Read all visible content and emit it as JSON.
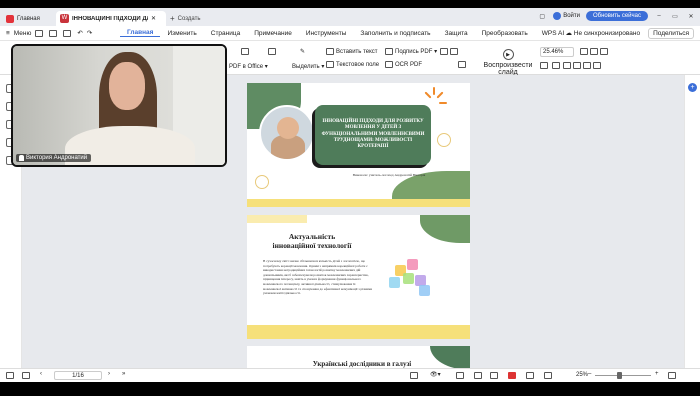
{
  "tabs": {
    "home_label": "Главная",
    "doc_title": "ІННОВАЦІЙНІ ПІДХОДИ ДЛ",
    "create_label": "Создать"
  },
  "account": {
    "signin_label": "Войти",
    "upgrade_label": "Обновить сейчас"
  },
  "menubar": {
    "menu_label": "Меню",
    "items": [
      "Главная",
      "Изменить",
      "Страница",
      "Примечание",
      "Инструменты",
      "Заполнить и подписать",
      "Защита",
      "Преобразовать",
      "WPS AI"
    ],
    "active": "Главная",
    "sync_label": "Не синхронизировано",
    "share_label": "Поделиться"
  },
  "ribbon": {
    "pdf_office_label": "PDF в Office",
    "select_label": "Выделить",
    "insert_text_label": "Вставить текст",
    "text_field_label": "Текстовое поле",
    "sign_pdf_label": "Подпись PDF",
    "ocr_label": "OCR PDF",
    "play_slides_label": "Воспроизвести слайд",
    "zoom_value": "25.46%"
  },
  "video": {
    "participant_name": "Виктория Андронатий"
  },
  "slides": {
    "slide1": {
      "title": "ІННОВАЦІЙНІ ПІДХОДИ ДЛЯ РОЗВИТКУ МОВЛЕННЯ У ДІТЕЙ З ФУНКЦІОНАЛЬНИМИ МОВЛЕННЄВИМИ ТРУДНОЩАМИ: МОЖЛИВОСТІ КРОТЕРАПІЇ",
      "author": "Виконала: учитель-логопед Андронатій Вікторія"
    },
    "slide2": {
      "title": "Актуальність інноваційної технології",
      "body": "В сучасному світі значно збільшилася кількість дітей з логопатією, що потребують корекції мовлення. Одним з напрямків корекційної роботи є використання нетрадиційних технологій розвитку мовленнєвих дій дошкільників, які б забезпечували розвиток мовленнєвих характеристик, підвищення інтересу, навіть в умовах формування функціонального мовленнєвого потенціалу, активної діяльності, стимулювання їх мовленнєвої активності та спонукання до ефективної комунікації з різними умовами життєдіяльності."
    },
    "slide3": {
      "title": "Українські дослідники в галузі"
    }
  },
  "status": {
    "page_indicator": "1/16",
    "zoom_percent": "25%"
  }
}
